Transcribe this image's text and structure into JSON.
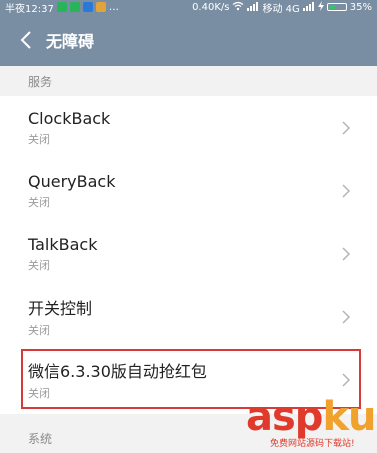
{
  "status_bar": {
    "time": "半夜12:37",
    "speed": "0.40K/s",
    "carrier": "移动 4G",
    "battery": "35%",
    "battery_level": 0.35
  },
  "header": {
    "title": "无障碍"
  },
  "sections": [
    {
      "label": "服务"
    },
    {
      "label": "系统"
    }
  ],
  "services": [
    {
      "name": "ClockBack",
      "status": "关闭"
    },
    {
      "name": "QueryBack",
      "status": "关闭"
    },
    {
      "name": "TalkBack",
      "status": "关闭"
    },
    {
      "name": "开关控制",
      "status": "关闭"
    },
    {
      "name": "微信6.3.30版自动抢红包",
      "status": "关闭"
    }
  ],
  "watermark": {
    "asp": "asp",
    "ku": "ku",
    "tld": ".com",
    "sub": "免费网站源码下载站!"
  },
  "colors": {
    "header_bg": "#7a8ea3",
    "highlight": "#d83a3a"
  }
}
